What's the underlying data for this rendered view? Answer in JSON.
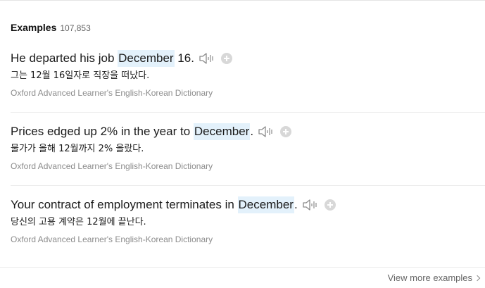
{
  "section": {
    "title": "Examples",
    "count": "107,853"
  },
  "examples": [
    {
      "en_before": "He departed his job ",
      "en_highlight": "December",
      "en_after": " 16.",
      "ko": "그는 12월 16일자로 직장을 떠났다.",
      "source": "Oxford Advanced Learner's English-Korean Dictionary"
    },
    {
      "en_before": "Prices edged up 2% in the year to ",
      "en_highlight": "December",
      "en_after": ".",
      "ko": "물가가 올해 12월까지 2% 올랐다.",
      "source": "Oxford Advanced Learner's English-Korean Dictionary"
    },
    {
      "en_before": "Your contract of employment terminates in ",
      "en_highlight": "December",
      "en_after": ".",
      "ko": "당신의 고용 계약은 12월에 끝난다.",
      "source": "Oxford Advanced Learner's English-Korean Dictionary"
    }
  ],
  "footer": {
    "more_label": "View more examples"
  },
  "icons": {
    "speaker": "speaker-icon",
    "add": "plus-circle-icon",
    "more": "chevron-right-icon"
  },
  "colors": {
    "highlight": "#e3f1fb",
    "source_text": "#8c8c8c",
    "divider": "#ececec"
  }
}
